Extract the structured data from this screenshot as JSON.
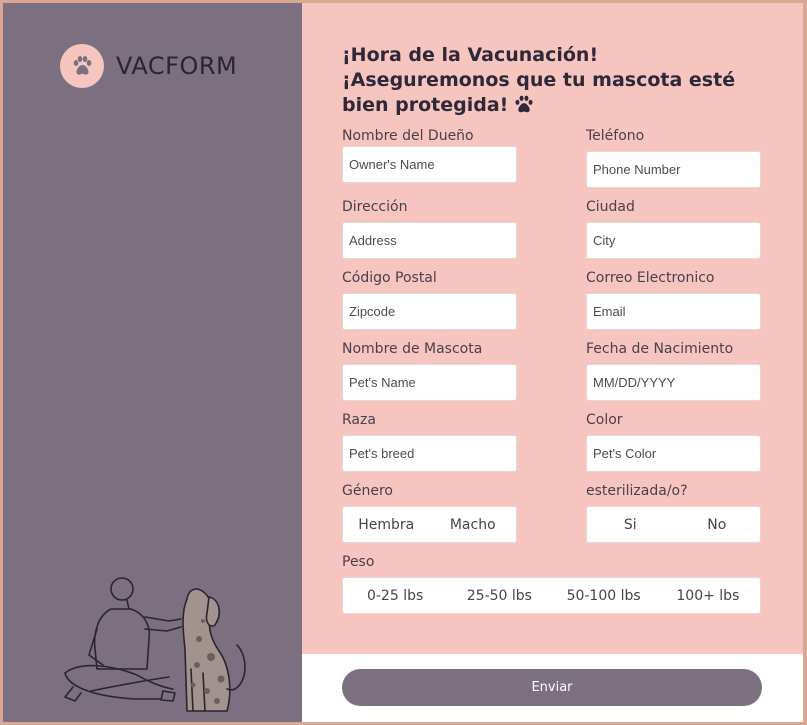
{
  "brand": {
    "name": "VACFORM"
  },
  "headline": {
    "line1": "¡Hora de la Vacunación!",
    "line2": "¡Aseguremonos que tu mascota esté",
    "line3": "bien protegida!"
  },
  "fields": {
    "owner_name": {
      "label": "Nombre del Dueño",
      "placeholder": "Owner's Name",
      "value": ""
    },
    "phone": {
      "label": "Teléfono",
      "placeholder": "Phone Number",
      "value": ""
    },
    "address": {
      "label": "Dirección",
      "placeholder": "Address",
      "value": ""
    },
    "city": {
      "label": "Ciudad",
      "placeholder": "City",
      "value": ""
    },
    "zipcode": {
      "label": "Código Postal",
      "placeholder": "Zipcode",
      "value": ""
    },
    "email": {
      "label": "Correo Electronico",
      "placeholder": "Email",
      "value": ""
    },
    "pet_name": {
      "label": "Nombre de Mascota",
      "placeholder": "Pet's Name",
      "value": ""
    },
    "birth_date": {
      "label": "Fecha de Nacimiento",
      "placeholder": "MM/DD/YYYY",
      "value": ""
    },
    "breed": {
      "label": "Raza",
      "placeholder": "Pet's breed",
      "value": ""
    },
    "color": {
      "label": "Color",
      "placeholder": "Pet's Color",
      "value": ""
    }
  },
  "gender": {
    "label": "Género",
    "options": [
      "Hembra",
      "Macho"
    ]
  },
  "sterilized": {
    "label": "esterilizada/o?",
    "options": [
      "Si",
      "No"
    ]
  },
  "weight": {
    "label": "Peso",
    "options": [
      "0-25 lbs",
      "25-50 lbs",
      "50-100 lbs",
      "100+ lbs"
    ]
  },
  "submit": {
    "label": "Enviar"
  },
  "colors": {
    "sidebar": "#7c6f80",
    "form_background": "#f7c5c0",
    "accent_dark": "#2e2838",
    "button": "#7c6f80"
  },
  "icons": [
    "paw-icon",
    "person-with-dog-illustration"
  ]
}
